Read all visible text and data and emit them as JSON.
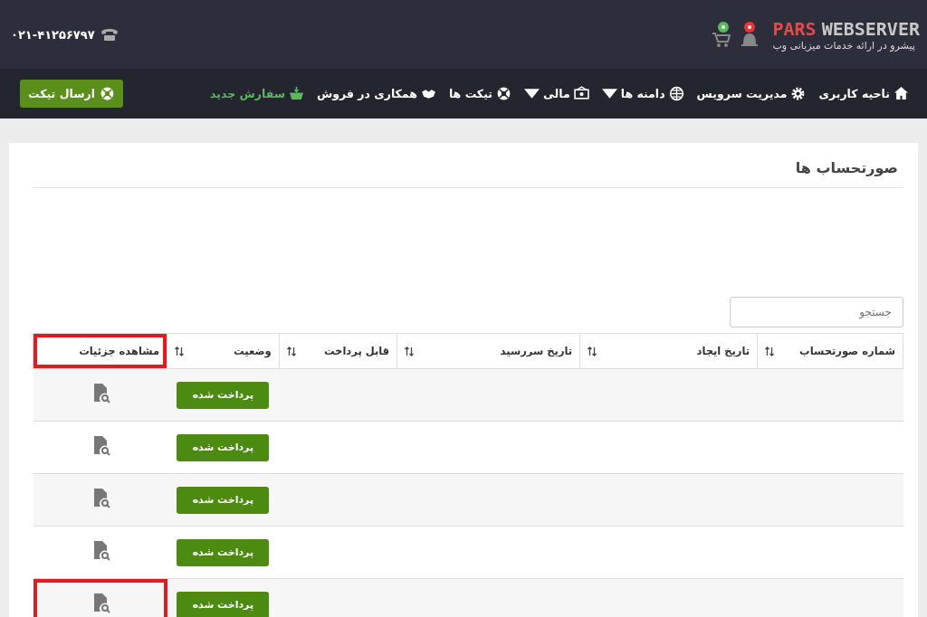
{
  "header": {
    "logo": {
      "word_1": "PARS",
      "word_2": "WEBSERVER",
      "tagline": "پیشرو در ارائه خدمات میزبانی وب"
    },
    "phone": "۰۲۱-۴۱۲۵۶۷۹۷"
  },
  "nav": {
    "items": [
      {
        "label": "ناحیه کاربری",
        "kind": "home",
        "dropdown": false,
        "color": "#ffffff"
      },
      {
        "label": "مدیریت سرویس",
        "kind": "gear",
        "dropdown": false,
        "color": "#ffffff"
      },
      {
        "label": "دامنه ها",
        "kind": "globe",
        "dropdown": true,
        "color": "#ffffff"
      },
      {
        "label": "مالی",
        "kind": "money",
        "dropdown": true,
        "color": "#ffffff"
      },
      {
        "label": "تیکت ها",
        "kind": "lifebuoy",
        "dropdown": false,
        "color": "#ffffff"
      },
      {
        "label": "همکاری در فروش",
        "kind": "handshake",
        "dropdown": false,
        "color": "#ffffff"
      },
      {
        "label": "سفارش جدید",
        "kind": "basket",
        "dropdown": false,
        "color": "#5cb85c"
      }
    ],
    "ticket_button": "ارسال تیکت"
  },
  "panel": {
    "title": "صورتحساب ها",
    "search": {
      "placeholder": "جستجو"
    },
    "table": {
      "columns": [
        {
          "label": "شماره صورتحساب",
          "sortable": true,
          "highlighted": false
        },
        {
          "label": "تاریخ ایجاد",
          "sortable": true,
          "highlighted": false
        },
        {
          "label": "تاریخ سررسید",
          "sortable": true,
          "highlighted": false
        },
        {
          "label": "قابل پرداخت",
          "sortable": true,
          "highlighted": false
        },
        {
          "label": "وضعیت",
          "sortable": true,
          "highlighted": false
        },
        {
          "label": "مشاهده جزئیات",
          "sortable": false,
          "highlighted": true
        }
      ],
      "rows": [
        {
          "status": "پرداخت شده",
          "highlighted": false
        },
        {
          "status": "پرداخت شده",
          "highlighted": false
        },
        {
          "status": "پرداخت شده",
          "highlighted": false
        },
        {
          "status": "پرداخت شده",
          "highlighted": false
        },
        {
          "status": "پرداخت شده",
          "highlighted": true
        }
      ]
    }
  }
}
